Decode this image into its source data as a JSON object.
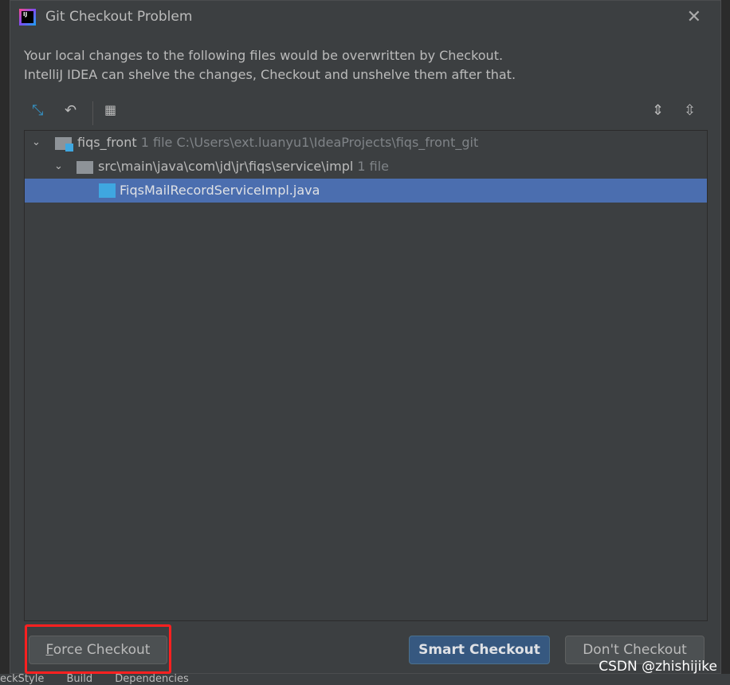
{
  "dialog": {
    "title": "Git Checkout Problem",
    "message_line1": "Your local changes to the following files would be overwritten by Checkout.",
    "message_line2": "IntelliJ IDEA can shelve the changes, Checkout and unshelve them after that."
  },
  "tree": {
    "root": {
      "name": "fiqs_front",
      "count": "1 file",
      "path": "C:\\Users\\ext.luanyu1\\IdeaProjects\\fiqs_front_git"
    },
    "folder": {
      "name": "src\\main\\java\\com\\jd\\jr\\fiqs\\service\\impl",
      "count": "1 file"
    },
    "file": {
      "name": "FiqsMailRecordServiceImpl.java"
    }
  },
  "buttons": {
    "force_mnemonic": "F",
    "force_rest": "orce Checkout",
    "smart": "Smart Checkout",
    "dont": "Don't Checkout"
  },
  "background": {
    "tabs": [
      "eckStyle",
      "Build",
      "Dependencies"
    ]
  },
  "watermark": "CSDN @zhishijike",
  "colors": {
    "selection": "#4b6eaf",
    "primary_button": "#365880",
    "highlight": "#ff2020"
  }
}
